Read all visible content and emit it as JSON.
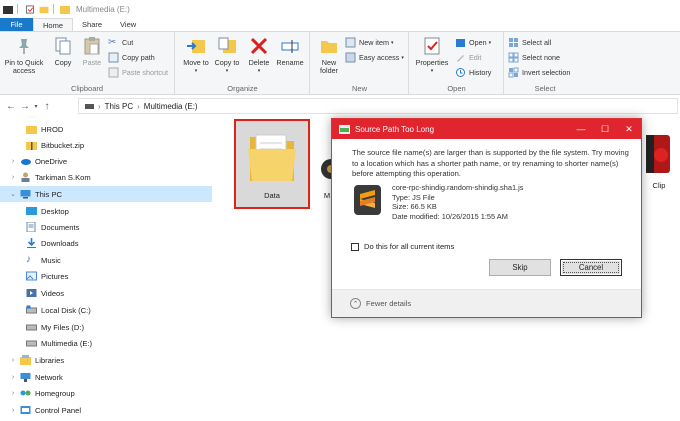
{
  "window": {
    "title": "Multimedia (E:)"
  },
  "tabs": [
    "File",
    "Home",
    "Share",
    "View"
  ],
  "ribbon": {
    "clipboard": {
      "label": "Clipboard",
      "pin": "Pin to Quick access",
      "copy": "Copy",
      "paste": "Paste",
      "cut": "Cut",
      "copy_path": "Copy path",
      "paste_shortcut": "Paste shortcut"
    },
    "organize": {
      "label": "Organize",
      "move_to": "Move to",
      "copy_to": "Copy to",
      "delete": "Delete",
      "rename": "Rename"
    },
    "new": {
      "label": "New",
      "new_folder": "New folder",
      "new_item": "New item",
      "easy_access": "Easy access"
    },
    "open": {
      "label": "Open",
      "properties": "Properties",
      "open": "Open",
      "edit": "Edit",
      "history": "History"
    },
    "select": {
      "label": "Select",
      "select_all": "Select all",
      "select_none": "Select none",
      "invert": "Invert selection"
    }
  },
  "address": {
    "crumbs": [
      "This PC",
      "Multimedia (E:)"
    ]
  },
  "nav": [
    {
      "label": "HROD",
      "icon": "folder-icon"
    },
    {
      "label": "Bitbucket.zip",
      "icon": "zip-icon"
    },
    {
      "label": "OneDrive",
      "icon": "onedrive-icon"
    },
    {
      "label": "Tarkiman S.Kom",
      "icon": "user-icon"
    },
    {
      "label": "This PC",
      "icon": "pc-icon",
      "selected": true
    },
    {
      "label": "Desktop",
      "icon": "desktop-icon"
    },
    {
      "label": "Documents",
      "icon": "documents-icon"
    },
    {
      "label": "Downloads",
      "icon": "downloads-icon"
    },
    {
      "label": "Music",
      "icon": "music-icon"
    },
    {
      "label": "Pictures",
      "icon": "pictures-icon"
    },
    {
      "label": "Videos",
      "icon": "videos-icon"
    },
    {
      "label": "Local Disk (C:)",
      "icon": "drive-icon"
    },
    {
      "label": "My Files (D:)",
      "icon": "drive-icon"
    },
    {
      "label": "Multimedia (E:)",
      "icon": "drive-icon"
    },
    {
      "label": "Libraries",
      "icon": "libraries-icon"
    },
    {
      "label": "Network",
      "icon": "network-icon"
    },
    {
      "label": "Homegroup",
      "icon": "homegroup-icon"
    },
    {
      "label": "Control Panel",
      "icon": "control-panel-icon"
    }
  ],
  "content": {
    "data_folder": "Data",
    "partial_left": "M",
    "partial_right": "Clip"
  },
  "dialog": {
    "title": "Source Path Too Long",
    "message": "The source file name(s) are larger than is supported by the file system. Try moving to a location which has a shorter path name, or try renaming to shorter name(s) before attempting this operation.",
    "file_name": "core-rpc-shindig.random-shindig.sha1.js",
    "file_type": "Type: JS File",
    "file_size": "Size: 66.5 KB",
    "file_date": "Date modified: 10/26/2015 1:55 AM",
    "checkbox": "Do this for all current items",
    "skip": "Skip",
    "cancel": "Cancel",
    "fewer": "Fewer details"
  },
  "colors": {
    "accent": "#1979ca",
    "dialog_title": "#e0252e",
    "selected": "#cce8ff"
  }
}
